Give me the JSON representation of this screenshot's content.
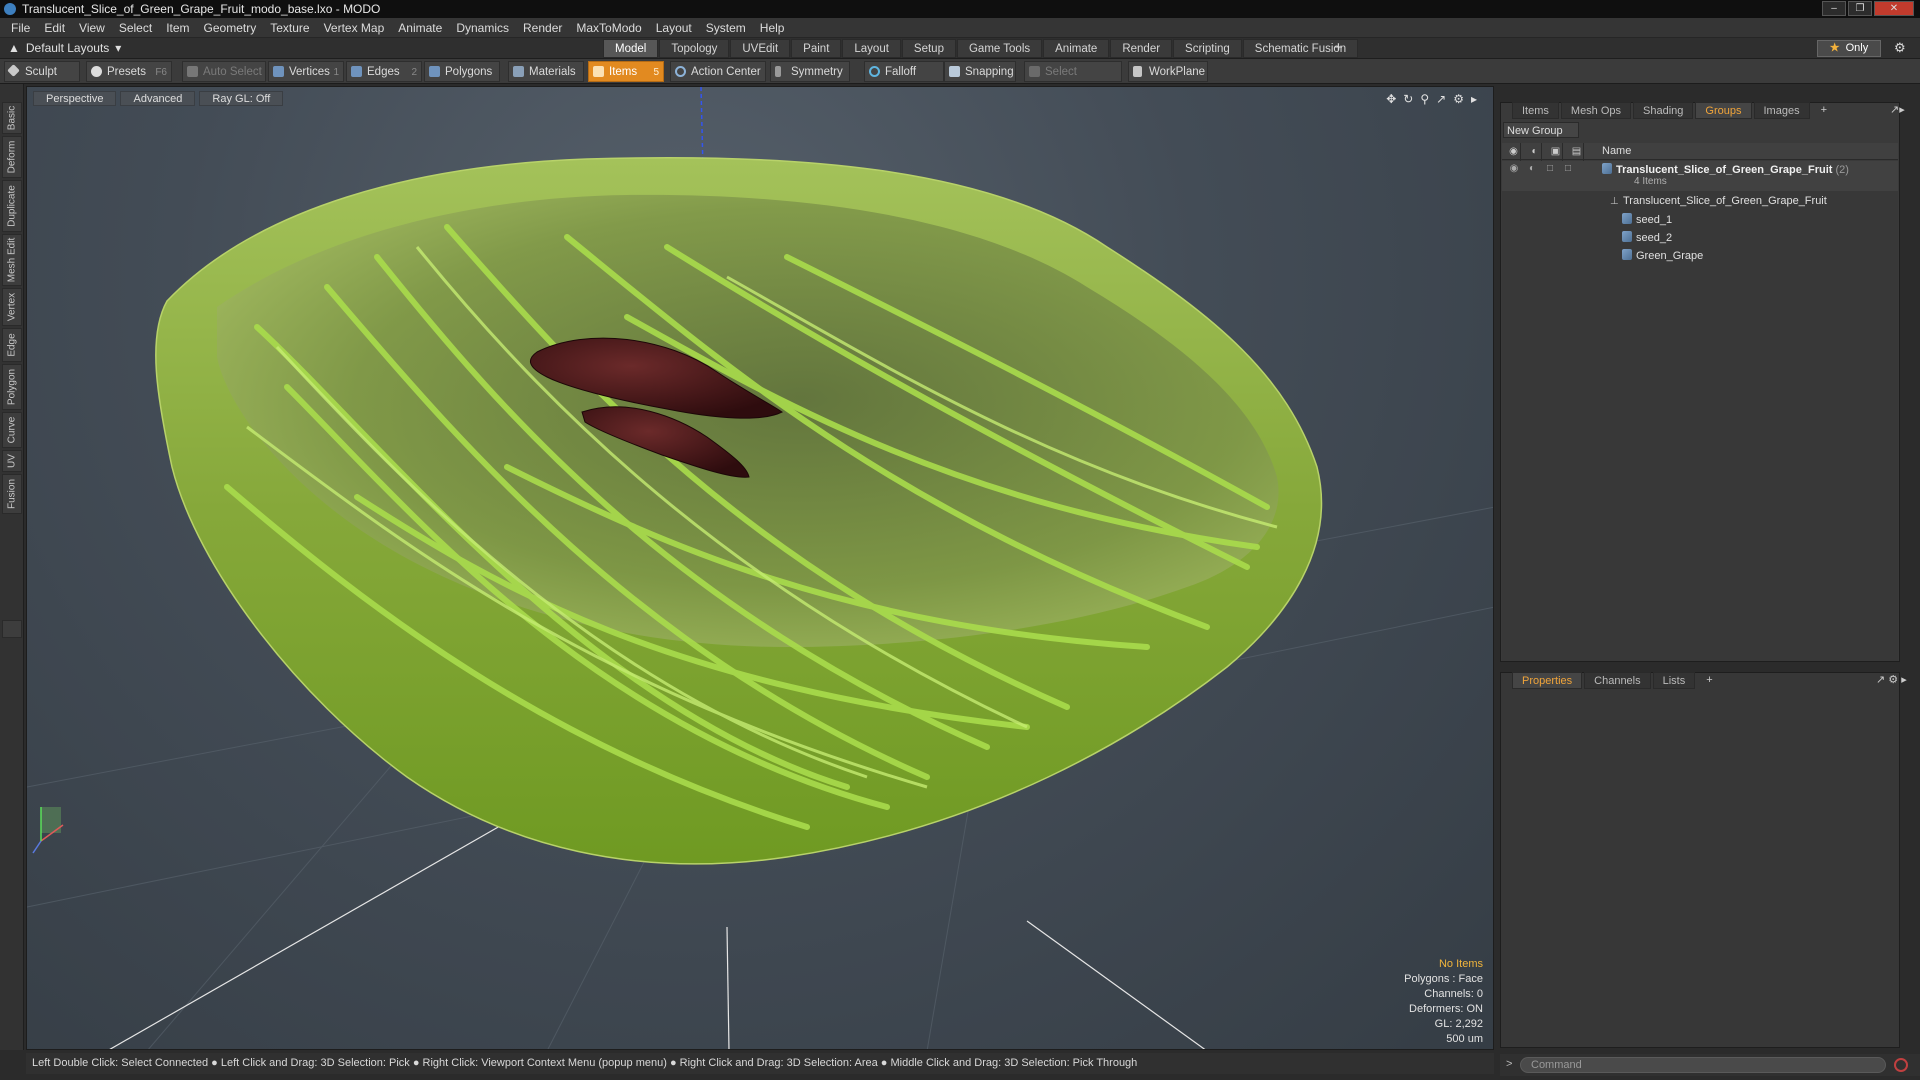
{
  "window": {
    "title": "Translucent_Slice_of_Green_Grape_Fruit_modo_base.lxo - MODO"
  },
  "menu": [
    "File",
    "Edit",
    "View",
    "Select",
    "Item",
    "Geometry",
    "Texture",
    "Vertex Map",
    "Animate",
    "Dynamics",
    "Render",
    "MaxToModo",
    "Layout",
    "System",
    "Help"
  ],
  "layout": {
    "dropdown": "Default Layouts",
    "tabs": [
      "Model",
      "Topology",
      "UVEdit",
      "Paint",
      "Layout",
      "Setup",
      "Game Tools",
      "Animate",
      "Render",
      "Scripting",
      "Schematic Fusion"
    ],
    "active_tab": "Model",
    "only_label": "Only"
  },
  "toolbar": {
    "sculpt": "Sculpt",
    "presets": "Presets",
    "presets_shortcut": "F6",
    "auto_select": "Auto Select",
    "vertices": "Vertices",
    "vertices_count": "1",
    "edges": "Edges",
    "edges_count": "2",
    "polygons": "Polygons",
    "materials": "Materials",
    "items": "Items",
    "items_count": "5",
    "action_center": "Action Center",
    "symmetry": "Symmetry",
    "falloff": "Falloff",
    "snapping": "Snapping",
    "select_through": "Select Through",
    "workplane": "WorkPlane"
  },
  "left_tabs": [
    "Basic",
    "Deform",
    "Duplicate",
    "Mesh Edit",
    "Vertex",
    "Edge",
    "Polygon",
    "Curve",
    "UV",
    "Fusion"
  ],
  "viewport": {
    "view_mode": "Perspective",
    "shading": "Advanced",
    "raygl": "Ray GL: Off",
    "stats": {
      "no_items": "No Items",
      "polygons": "Polygons : Face",
      "channels": "Channels: 0",
      "deformers": "Deformers: ON",
      "gl": "GL: 2,292",
      "unit": "500 um"
    }
  },
  "statusbar": "Left Double Click: Select Connected ● Left Click and Drag: 3D Selection: Pick ● Right Click: Viewport Context Menu (popup menu) ● Right Click and Drag: 3D Selection: Area ● Middle Click and Drag: 3D Selection: Pick Through",
  "right_panel": {
    "tabs": [
      "Items",
      "Mesh Ops",
      "Shading",
      "Groups",
      "Images"
    ],
    "active_tab": "Groups",
    "new_group": "New Group",
    "name_header": "Name",
    "group": {
      "name": "Translucent_Slice_of_Green_Grape_Fruit",
      "count": "(2)",
      "subtitle": "4 Items",
      "children": [
        "Translucent_Slice_of_Green_Grape_Fruit",
        "seed_1",
        "seed_2",
        "Green_Grape"
      ]
    },
    "bottom_tabs": [
      "Properties",
      "Channels",
      "Lists"
    ],
    "bottom_active": "Properties",
    "command_placeholder": "Command"
  }
}
